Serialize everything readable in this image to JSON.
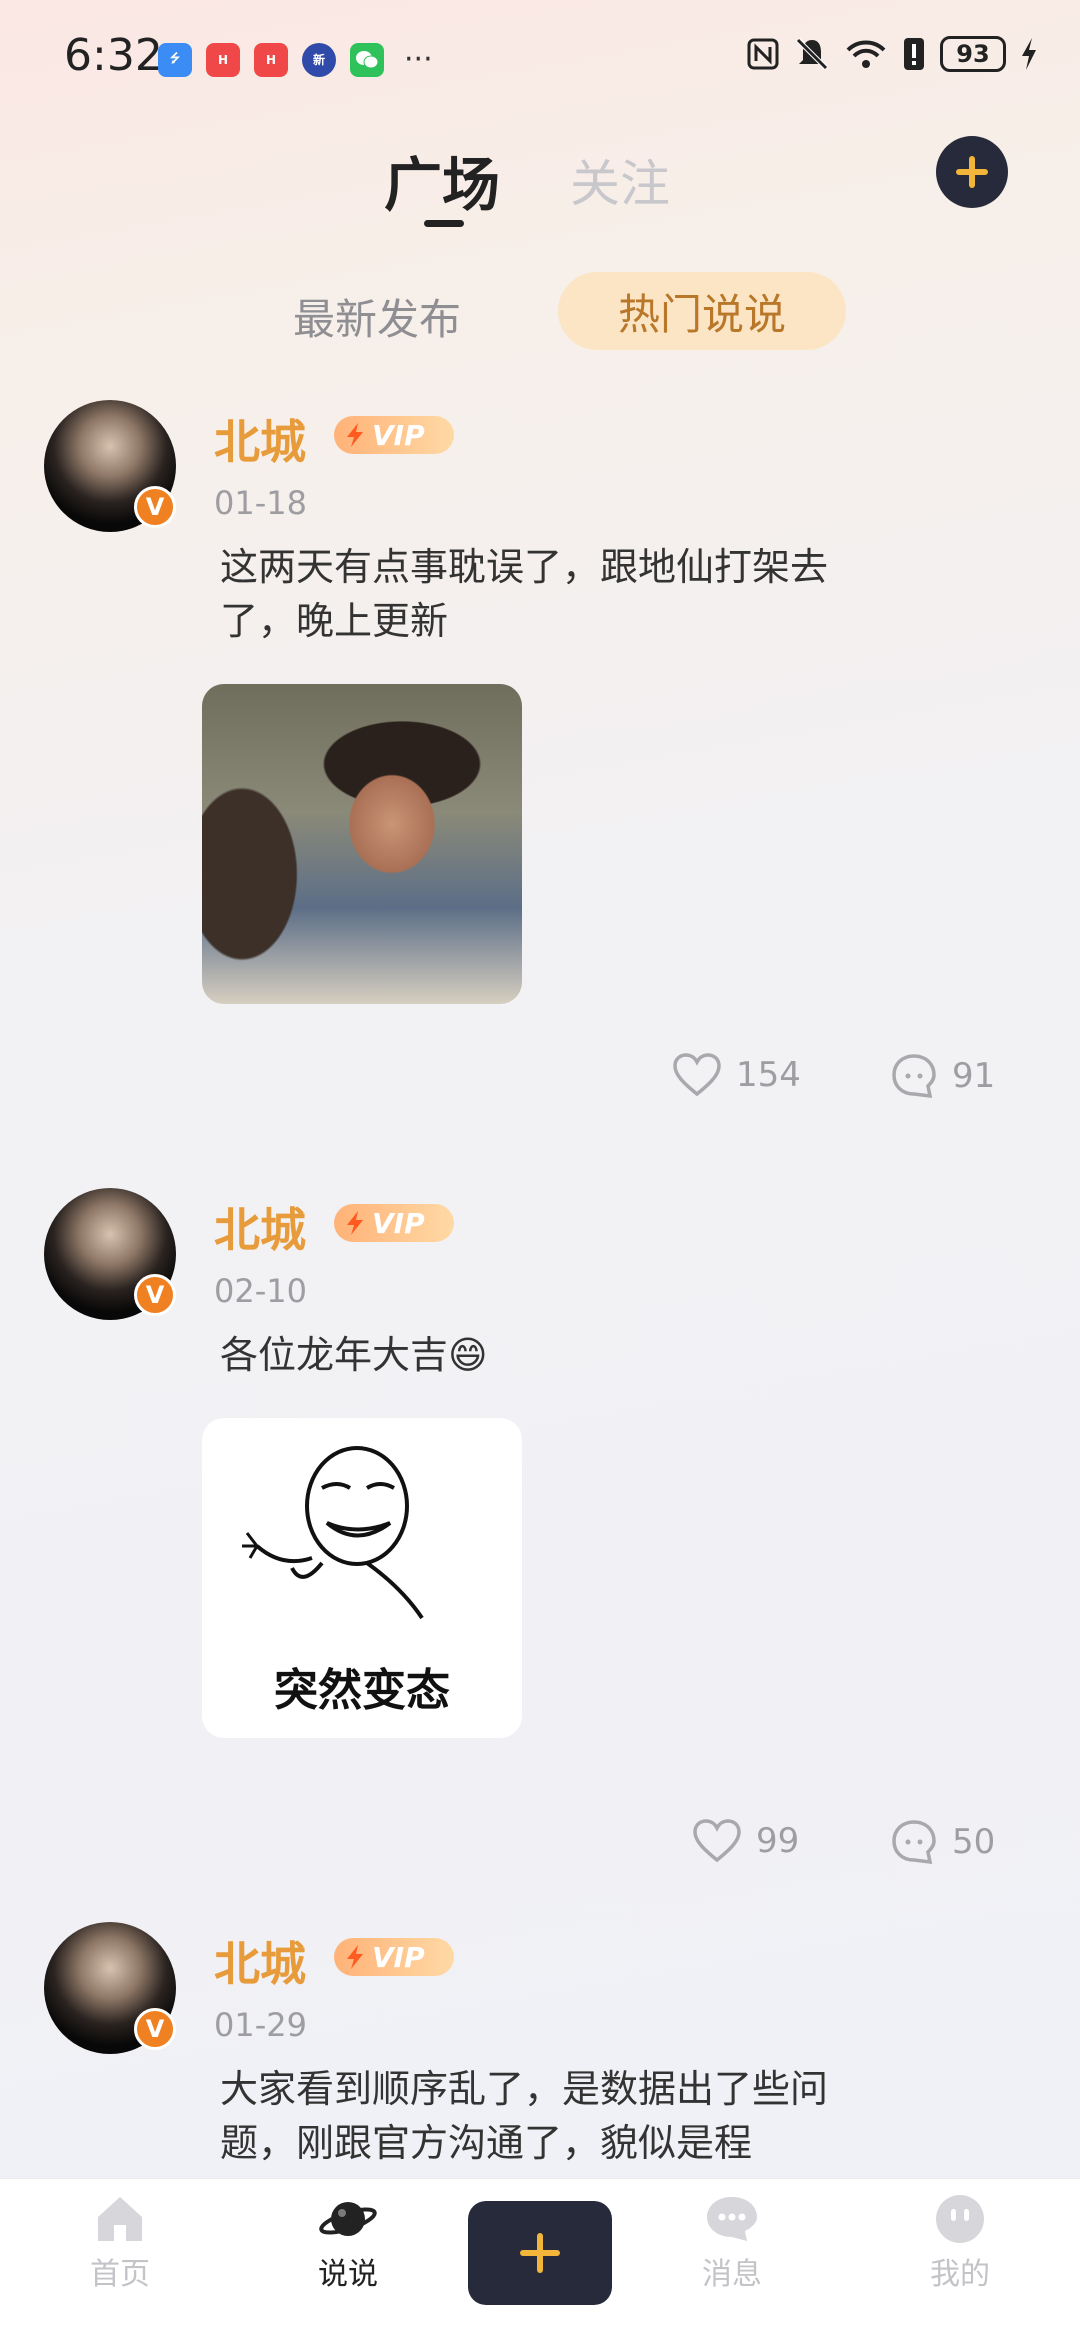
{
  "status_bar": {
    "time": "6:32",
    "battery": "93",
    "icons": [
      "usb-icon",
      "huawei-app-icon",
      "huawei-app-icon",
      "sina-news-icon",
      "wechat-icon"
    ]
  },
  "header": {
    "tabs": [
      {
        "label": "广场",
        "active": true
      },
      {
        "label": "关注",
        "active": false
      }
    ]
  },
  "sub_tabs": [
    {
      "label": "最新发布",
      "active": false
    },
    {
      "label": "热门说说",
      "active": true
    }
  ],
  "posts": [
    {
      "username": "北城",
      "vip": "VIP",
      "date": "01-18",
      "text": "这两天有点事耽误了，跟地仙打架去了，晚上更新",
      "likes": "154",
      "comments": "91"
    },
    {
      "username": "北城",
      "vip": "VIP",
      "date": "02-10",
      "text": "各位龙年大吉😄",
      "image_caption": "突然变态",
      "likes": "99",
      "comments": "50"
    },
    {
      "username": "北城",
      "vip": "VIP",
      "date": "01-29",
      "text": "大家看到顺序乱了，是数据出了些问题，刚跟官方沟通了，貌似是程"
    }
  ],
  "bottom_nav": [
    {
      "label": "首页",
      "icon": "home-icon",
      "active": false
    },
    {
      "label": "说说",
      "icon": "planet-icon",
      "active": true
    },
    {
      "label": "",
      "icon": "plus-icon",
      "active": false
    },
    {
      "label": "消息",
      "icon": "chat-bubble-icon",
      "active": false
    },
    {
      "label": "我的",
      "icon": "profile-face-icon",
      "active": false
    }
  ],
  "colors": {
    "accent": "#e79b3a",
    "hot_pill": "#fbe5c5",
    "dark_button": "#262a3a",
    "vip_badge": "#ffb277"
  }
}
